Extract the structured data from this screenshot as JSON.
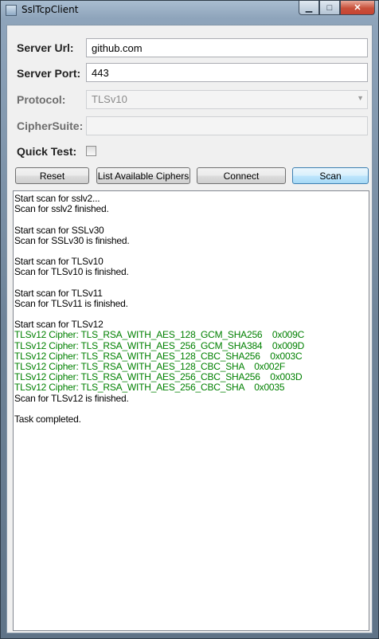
{
  "window": {
    "title": "SslTcpClient",
    "minimize_glyph": "▁",
    "maximize_glyph": "□",
    "close_glyph": "✕"
  },
  "form": {
    "server_url_label": "Server Url:",
    "server_url_value": "github.com",
    "server_port_label": "Server Port:",
    "server_port_value": "443",
    "protocol_label": "Protocol:",
    "protocol_value": "TLSv10",
    "ciphersuite_label": "CipherSuite:",
    "ciphersuite_value": "",
    "quick_test_label": "Quick Test:",
    "quick_test_checked": false
  },
  "buttons": {
    "reset": "Reset",
    "list_ciphers": "List Available Ciphers",
    "connect": "Connect",
    "scan": "Scan"
  },
  "log_lines": [
    {
      "text": "Start scan for sslv2...",
      "color": "#000000"
    },
    {
      "text": "Scan for sslv2 finished.",
      "color": "#000000"
    },
    {
      "text": "",
      "color": "#000000"
    },
    {
      "text": "Start scan for SSLv30",
      "color": "#000000"
    },
    {
      "text": "Scan for SSLv30 is finished.",
      "color": "#000000"
    },
    {
      "text": "",
      "color": "#000000"
    },
    {
      "text": "Start scan for TLSv10",
      "color": "#000000"
    },
    {
      "text": "Scan for TLSv10 is finished.",
      "color": "#000000"
    },
    {
      "text": "",
      "color": "#000000"
    },
    {
      "text": "Start scan for TLSv11",
      "color": "#000000"
    },
    {
      "text": "Scan for TLSv11 is finished.",
      "color": "#000000"
    },
    {
      "text": "",
      "color": "#000000"
    },
    {
      "text": "Start scan for TLSv12",
      "color": "#000000"
    },
    {
      "text": "TLSv12 Cipher: TLS_RSA_WITH_AES_128_GCM_SHA256    0x009C",
      "color": "#008000"
    },
    {
      "text": "TLSv12 Cipher: TLS_RSA_WITH_AES_256_GCM_SHA384    0x009D",
      "color": "#008000"
    },
    {
      "text": "TLSv12 Cipher: TLS_RSA_WITH_AES_128_CBC_SHA256    0x003C",
      "color": "#008000"
    },
    {
      "text": "TLSv12 Cipher: TLS_RSA_WITH_AES_128_CBC_SHA    0x002F",
      "color": "#008000"
    },
    {
      "text": "TLSv12 Cipher: TLS_RSA_WITH_AES_256_CBC_SHA256    0x003D",
      "color": "#008000"
    },
    {
      "text": "TLSv12 Cipher: TLS_RSA_WITH_AES_256_CBC_SHA    0x0035",
      "color": "#008000"
    },
    {
      "text": "Scan for TLSv12 is finished.",
      "color": "#000000"
    },
    {
      "text": "",
      "color": "#000000"
    },
    {
      "text": "Task completed.",
      "color": "#000000"
    }
  ]
}
